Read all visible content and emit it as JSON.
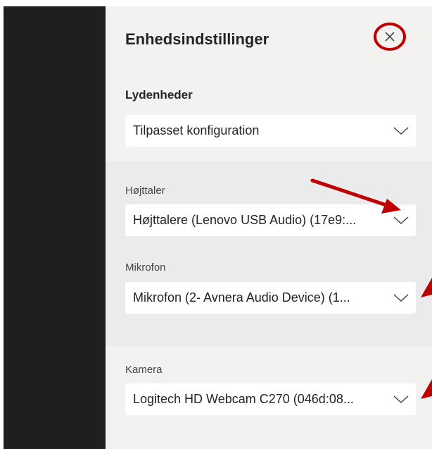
{
  "panel": {
    "title": "Enhedsindstillinger",
    "close_icon": "close-icon"
  },
  "audio": {
    "heading": "Lydenheder",
    "selected": "Tilpasset konfiguration"
  },
  "speaker": {
    "label": "Højttaler",
    "value": "Højttalere (Lenovo USB Audio) (17e9:..."
  },
  "microphone": {
    "label": "Mikrofon",
    "value": "Mikrofon (2- Avnera Audio Device) (1..."
  },
  "camera": {
    "label": "Kamera",
    "value": "Logitech HD Webcam C270 (046d:08..."
  },
  "colors": {
    "annotation": "#c00000",
    "panel_bg": "#f3f2f1",
    "section_bg": "#ebebeb",
    "dark_strip": "#1f1f1f"
  }
}
